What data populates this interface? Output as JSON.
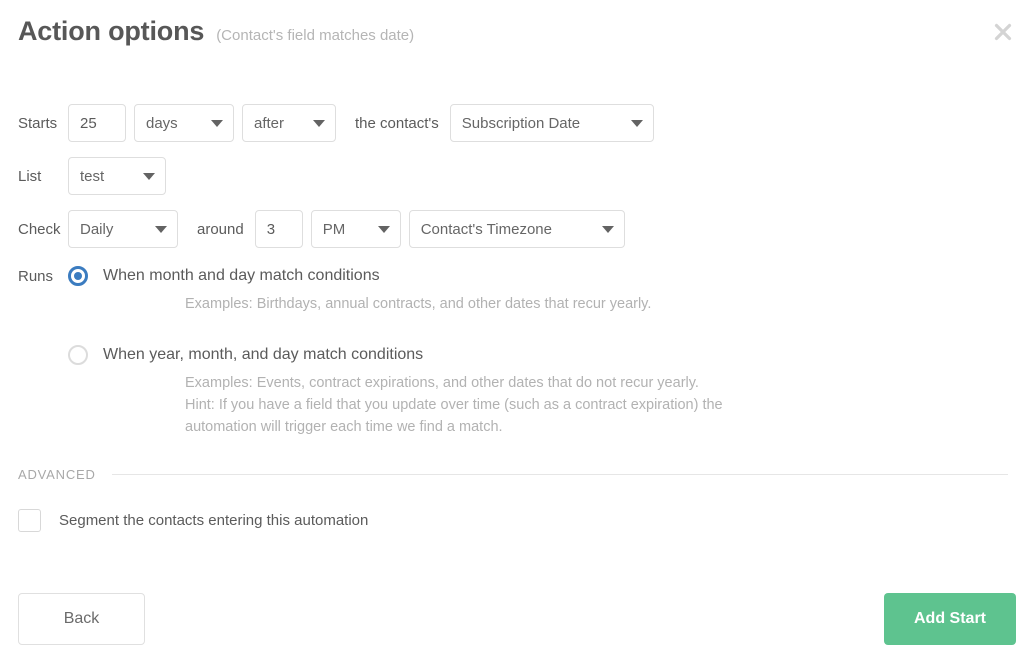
{
  "header": {
    "title": "Action options",
    "subtitle": "(Contact's field matches date)",
    "close_icon": "close-icon"
  },
  "form": {
    "starts": {
      "label": "Starts",
      "amount_value": "25",
      "amount_placeholder": "0",
      "unit_value": "days",
      "direction_value": "after",
      "middle_text": "the contact's",
      "field_value": "Subscription Date"
    },
    "list": {
      "label": "List",
      "value": "test"
    },
    "check": {
      "label": "Check",
      "frequency_value": "Daily",
      "around_text": "around",
      "hour_value": "3",
      "hour_placeholder": "0",
      "meridiem_value": "PM",
      "timezone_value": "Contact's Timezone"
    },
    "runs": {
      "label": "Runs",
      "options": [
        {
          "label": "When month and day match conditions",
          "selected": true,
          "description": [
            "Examples: Birthdays, annual contracts, and other dates that recur yearly."
          ]
        },
        {
          "label": "When year, month, and day match conditions",
          "selected": false,
          "description": [
            "Examples: Events, contract expirations, and other dates that do not recur yearly.",
            "Hint: If you have a field that you update over time (such as a contract expiration) the",
            "automation will trigger each time we find a match."
          ]
        }
      ]
    }
  },
  "advanced": {
    "section_label": "ADVANCED",
    "segment_checkbox_label": "Segment the contacts entering this automation",
    "segment_checked": false
  },
  "footer": {
    "back_label": "Back",
    "add_start_label": "Add Start"
  },
  "colors": {
    "accent_green": "#5ec38f",
    "radio_blue": "#3b7cc0",
    "text_primary": "#5b5b5b",
    "text_muted": "#b2b2b2",
    "border": "#dedede"
  }
}
